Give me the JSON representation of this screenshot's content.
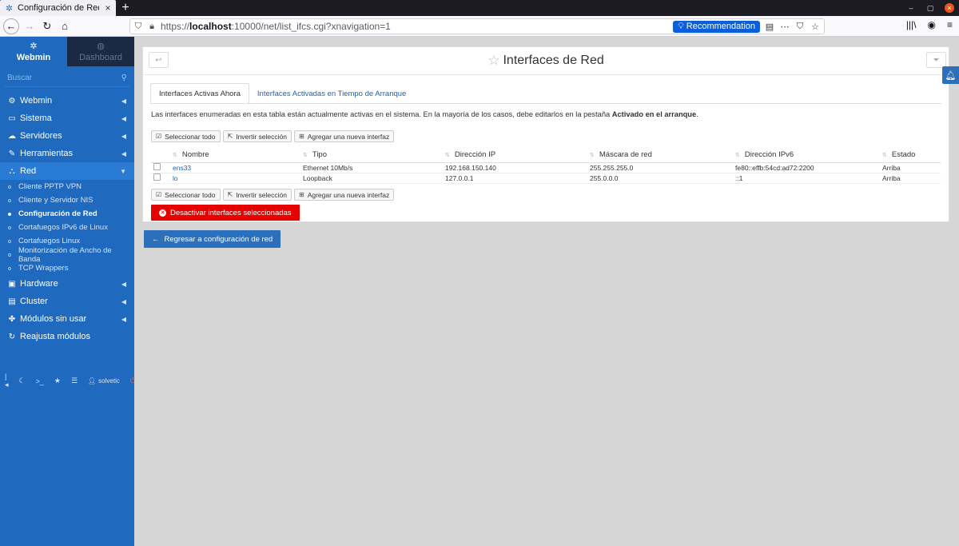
{
  "browser": {
    "tab_title": "Configuración de Red/Ir",
    "new_tab": "+",
    "tab_close": "×",
    "url_scheme": "https://",
    "url_host": "localhost",
    "url_rest": ":10000/net/list_ifcs.cgi?xnavigation=1",
    "recommendation": "Recommendation"
  },
  "sidebar": {
    "tab_webmin": "Webmin",
    "tab_dashboard": "Dashboard",
    "search_placeholder": "Buscar",
    "items": [
      {
        "label": "Webmin",
        "icon": "gear-icon"
      },
      {
        "label": "Sistema",
        "icon": "monitor-icon"
      },
      {
        "label": "Servidores",
        "icon": "cloud-icon"
      },
      {
        "label": "Herramientas",
        "icon": "wrench-icon"
      },
      {
        "label": "Red",
        "icon": "network-icon"
      }
    ],
    "sub_items": [
      {
        "label": "Cliente PPTP VPN"
      },
      {
        "label": "Cliente y Servidor NIS"
      },
      {
        "label": "Configuración de Red"
      },
      {
        "label": "Cortafuegos IPv6 de Linux"
      },
      {
        "label": "Cortafuegos Linux"
      },
      {
        "label": "Monitorización de Ancho de Banda"
      },
      {
        "label": "TCP Wrappers"
      }
    ],
    "items_after": [
      {
        "label": "Hardware"
      },
      {
        "label": "Cluster"
      },
      {
        "label": "Módulos sin usar"
      },
      {
        "label": "Reajusta módulos"
      }
    ],
    "footer_user": "solvetic"
  },
  "main": {
    "page_title": "Interfaces de Red",
    "tabs": [
      {
        "label": "Interfaces Activas Ahora"
      },
      {
        "label": "Interfaces Activadas en Tiempo de Arranque"
      }
    ],
    "desc_pre": "Las interfaces enumeradas en esta tabla están actualmente activas en el sistema. En la mayoría de los casos, debe editarlos en la pestaña ",
    "desc_bold": "Activado en el arranque",
    "desc_post": ".",
    "btn_select_all": "Seleccionar todo",
    "btn_invert": "Invertir selección",
    "btn_add": "Agregar una nueva interfaz",
    "columns": [
      "Nombre",
      "Tipo",
      "Dirección IP",
      "Máscara de red",
      "Dirección IPv6",
      "Estado"
    ],
    "rows": [
      {
        "name": "ens33",
        "type": "Ethernet 10Mb/s",
        "ip": "192.168.150.140",
        "mask": "255.255.255.0",
        "ipv6": "fe80::effb:54cd:ad72:2200",
        "state": "Arriba"
      },
      {
        "name": "lo",
        "type": "Loopback",
        "ip": "127.0.0.1",
        "mask": "255.0.0.0",
        "ipv6": "::1",
        "state": "Arriba"
      }
    ],
    "btn_deactivate": "Desactivar interfaces seleccionadas",
    "btn_return": "Regresar a configuración de red"
  }
}
